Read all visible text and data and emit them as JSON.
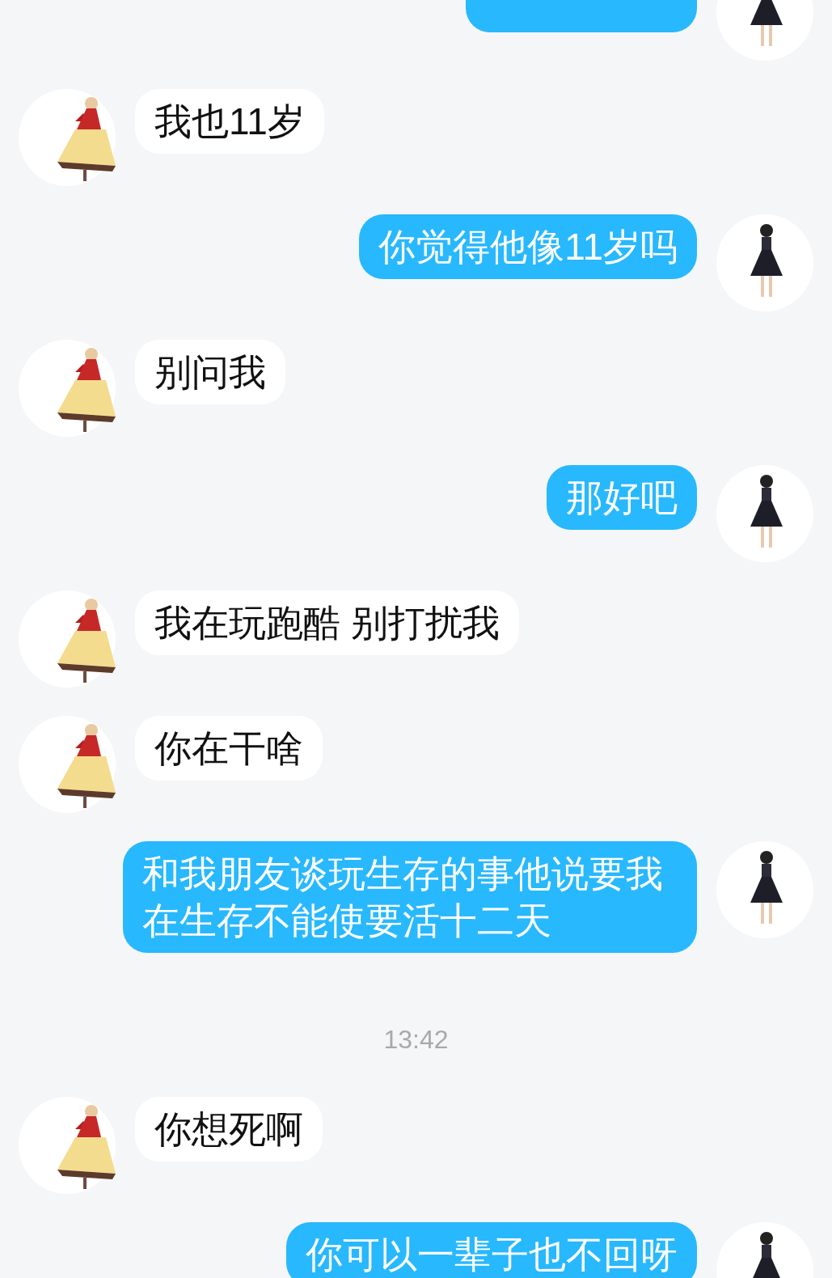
{
  "messages": [
    {
      "kind": "sent_cut"
    },
    {
      "kind": "received",
      "text": "我也11岁"
    },
    {
      "kind": "sent",
      "text": "你觉得他像11岁吗"
    },
    {
      "kind": "received",
      "text": "别问我"
    },
    {
      "kind": "sent",
      "text": "那好吧"
    },
    {
      "kind": "received",
      "text": "我在玩跑酷 别打扰我"
    },
    {
      "kind": "received",
      "text": "你在干啥"
    },
    {
      "kind": "sent",
      "text": "和我朋友谈玩生存的事他说要我在生存不能使要活十二天"
    },
    {
      "kind": "time",
      "text": "13:42"
    },
    {
      "kind": "received",
      "text": "你想死啊"
    },
    {
      "kind": "sent",
      "text": "你可以一辈子也不回呀"
    }
  ]
}
